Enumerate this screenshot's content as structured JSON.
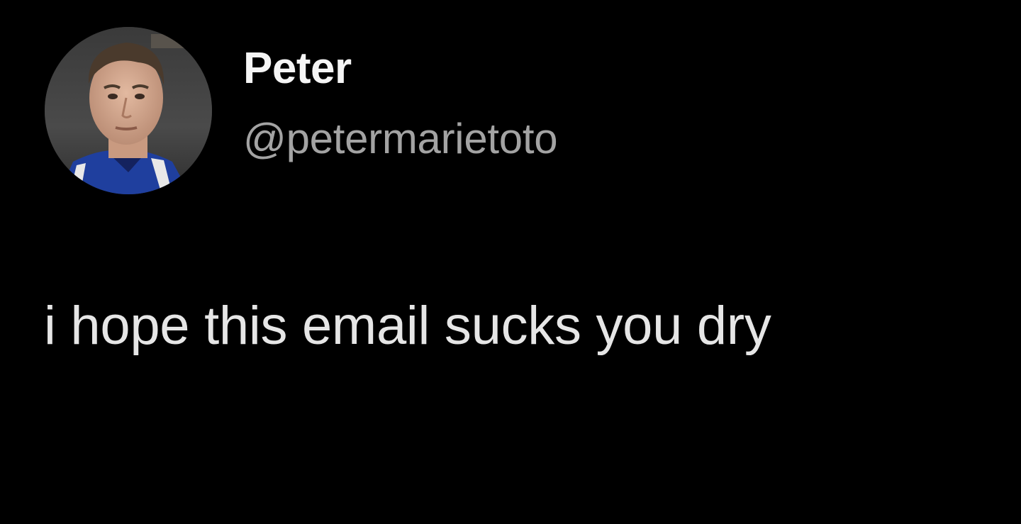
{
  "tweet": {
    "author": {
      "display_name": "Peter",
      "handle": "@petermarietoto",
      "avatar_icon": "profile-photo"
    },
    "text": "i hope this email sucks you dry"
  },
  "colors": {
    "background": "#000000",
    "display_name": "#f5f5f5",
    "handle": "#a3a3a3",
    "text": "#e6e6e6"
  }
}
